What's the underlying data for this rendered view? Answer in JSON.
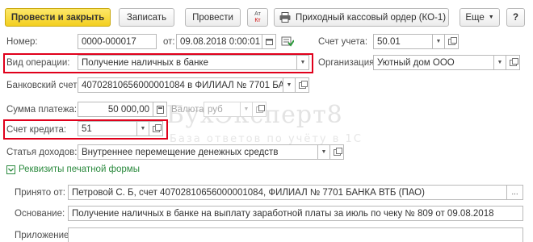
{
  "toolbar": {
    "post_and_close": "Провести и закрыть",
    "save": "Записать",
    "post": "Провести",
    "dtkt_top": "Ат",
    "dtkt_bottom": "Кт",
    "print_order": "Приходный кассовый ордер (КО-1)",
    "more": "Еще",
    "help": "?"
  },
  "form": {
    "number_label": "Номер:",
    "number_value": "0000-000017",
    "date_label": "от:",
    "date_value": "09.08.2018  0:00:01",
    "account_label": "Счет учета:",
    "account_value": "50.01",
    "operation_label": "Вид операции:",
    "operation_value": "Получение наличных в банке",
    "organization_label": "Организация:",
    "organization_value": "Уютный дом ООО",
    "bank_account_label": "Банковский счет:",
    "bank_account_value": "40702810656000001084 в ФИЛИАЛ № 7701 БАНКА ВТБ (ПАО)",
    "amount_label": "Сумма платежа:",
    "amount_value": "50 000,00",
    "currency_label": "Валюта:",
    "currency_value": "руб",
    "credit_account_label": "Счет кредита:",
    "credit_account_value": "51",
    "income_item_label": "Статья доходов:",
    "income_item_value": "Внутреннее перемещение денежных средств",
    "print_details_label": "Реквизиты печатной формы",
    "received_from_label": "Принято от:",
    "received_from_value": "Петровой С. Б, счет 40702810656000001084, ФИЛИАЛ № 7701 БАНКА ВТБ (ПАО)",
    "basis_label": "Основание:",
    "basis_value": "Получение наличных в банке на выплату заработной платы за июль по чеку № 809 от 09.08.2018",
    "attachment_label": "Приложение:",
    "attachment_value": "",
    "ellipsis": "..."
  },
  "watermark": {
    "brand": "БухЭксперт8",
    "tagline": "База ответов по учёту в 1С"
  },
  "colors": {
    "primary_button": "#f3cf1f",
    "highlight_border": "#e0001b",
    "group_link": "#2b8a3e"
  }
}
